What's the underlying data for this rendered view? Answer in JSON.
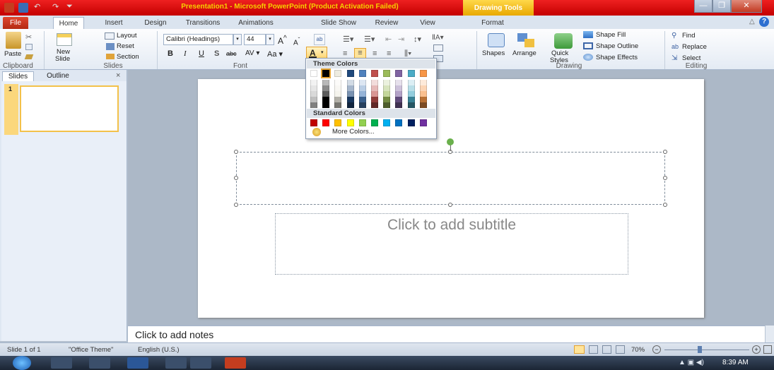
{
  "window": {
    "title": "Presentation1 - Microsoft PowerPoint (Product Activation Failed)",
    "context_tab_group": "Drawing Tools",
    "titlebar_color": "#d60c0c"
  },
  "tabs": [
    "File",
    "Home",
    "Insert",
    "Design",
    "Transitions",
    "Animations",
    "Slide Show",
    "Review",
    "View",
    "Format"
  ],
  "ribbon": {
    "clipboard": {
      "paste": "Paste",
      "label": "Clipboard"
    },
    "slides": {
      "new_slide": "New",
      "new_slide_2": "Slide",
      "layout": "Layout",
      "reset": "Reset",
      "section": "Section",
      "label": "Slides"
    },
    "font": {
      "font_name": "Calibri (Headings)",
      "font_size": "44",
      "label": "Font",
      "bold": "B",
      "italic": "I",
      "underline": "U",
      "shadow": "S",
      "strike": "abc",
      "spacing": "AV",
      "case": "Aa",
      "grow": "A",
      "shrink": "A"
    },
    "drawing": {
      "shapes": "Shapes",
      "arrange": "Arrange",
      "quick": "Quick",
      "styles": "Styles",
      "fill": "Shape Fill",
      "outline": "Shape Outline",
      "effects": "Shape Effects",
      "label": "Drawing"
    },
    "editing": {
      "find": "Find",
      "replace": "Replace",
      "select": "Select",
      "label": "Editing"
    }
  },
  "left_pane": {
    "tab_slides": "Slides",
    "tab_outline": "Outline",
    "slide_number": "1"
  },
  "slide": {
    "subtitle_placeholder": "Click to add subtitle"
  },
  "notes": {
    "placeholder": "Click to add notes"
  },
  "status": {
    "slide": "Slide 1 of 1",
    "theme": "\"Office Theme\"",
    "language": "English (U.S.)",
    "zoom": "70%"
  },
  "taskbar": {
    "time": "8:39 AM"
  },
  "color_dropdown": {
    "theme_header": "Theme Colors",
    "standard_header": "Standard Colors",
    "more": "More Colors...",
    "theme_top": [
      "#ffffff",
      "#000000",
      "#eeece1",
      "#1f497d",
      "#4f81bd",
      "#c0504d",
      "#9bbb59",
      "#8064a2",
      "#4bacc6",
      "#f79646"
    ],
    "standard": [
      "#c00000",
      "#ff0000",
      "#ffc000",
      "#ffff00",
      "#92d050",
      "#00b050",
      "#00b0f0",
      "#0070c0",
      "#002060",
      "#7030a0"
    ]
  }
}
